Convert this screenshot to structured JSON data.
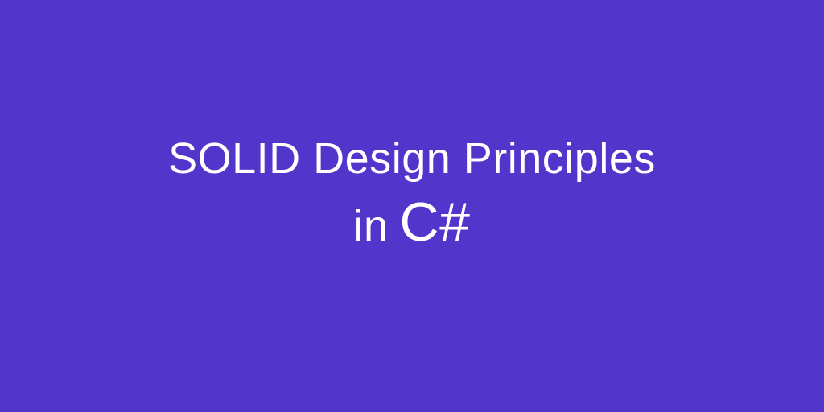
{
  "title": {
    "line1": "SOLID Design Principles",
    "line2_prefix": "in",
    "line2_lang": "C#"
  },
  "colors": {
    "background": "#5236cb",
    "text": "#ffffff"
  }
}
